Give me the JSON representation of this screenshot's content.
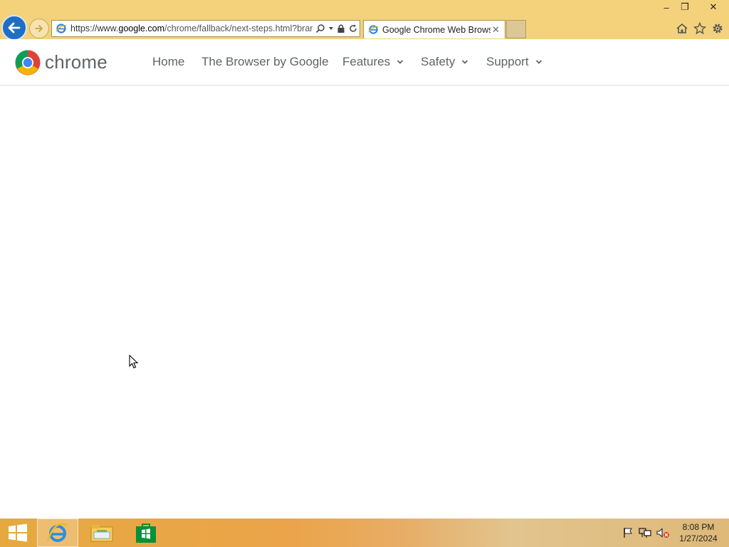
{
  "browser": {
    "address_bar": {
      "url_prefix": "https://www.",
      "url_domain": "google.com",
      "url_path": "/chrome/fallback/next-steps.html?brar"
    },
    "tab": {
      "title": "Google Chrome Web Brows...",
      "close_glyph": "✕"
    },
    "window_controls": {
      "minimize": "–",
      "restore": "❐",
      "close": "✕"
    }
  },
  "page": {
    "brand": "chrome",
    "nav": [
      {
        "label": "Home",
        "has_dropdown": false
      },
      {
        "label": "The Browser by Google",
        "has_dropdown": false
      },
      {
        "label": "Features",
        "has_dropdown": true
      },
      {
        "label": "Safety",
        "has_dropdown": true
      },
      {
        "label": "Support",
        "has_dropdown": true
      }
    ]
  },
  "taskbar": {
    "clock": {
      "time": "8:08 PM",
      "date": "1/27/2024"
    }
  },
  "colors": {
    "titlebar": "#f3d27b",
    "back_button": "#1e6fc4",
    "nav_text": "#5f6368"
  },
  "icons": [
    "back-arrow-icon",
    "forward-arrow-icon",
    "ie-page-icon",
    "search-icon",
    "lock-icon",
    "refresh-icon",
    "home-icon",
    "favorites-star-icon",
    "gear-icon",
    "chrome-logo-icon",
    "windows-start-icon",
    "internet-explorer-icon",
    "file-explorer-icon",
    "store-icon",
    "flag-icon",
    "network-icon",
    "volume-muted-icon",
    "mouse-cursor-icon"
  ]
}
